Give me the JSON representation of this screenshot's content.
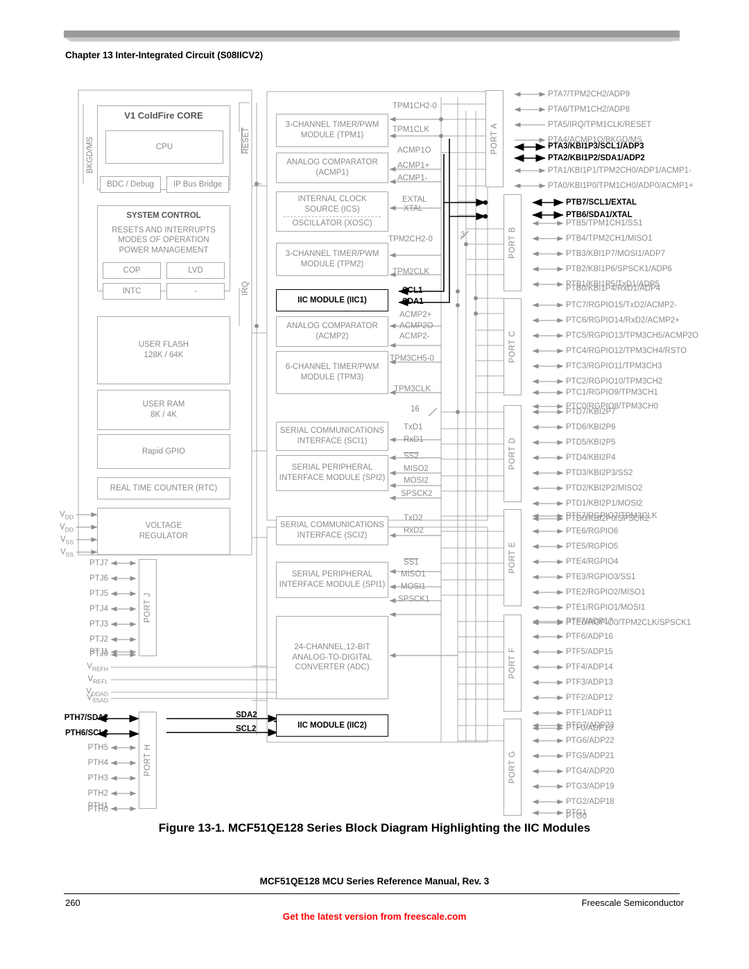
{
  "header": {
    "chapter": "Chapter 13 Inter-Integrated Circuit (S08IICV2)"
  },
  "footer": {
    "figure_caption": "Figure 13-1. MCF51QE128 Series Block Diagram Highlighting the IIC Modules",
    "manual_line": "MCF51QE128 MCU Series Reference Manual, Rev. 3",
    "page_number": "260",
    "company": "Freescale Semiconductor",
    "notice": "Get the latest version from freescale.com"
  },
  "colors": {
    "normal": "#8a8a8a",
    "highlight": "#000000",
    "notice_red": "#ff0000",
    "rule": "#9a9a9a"
  },
  "core": {
    "title": "V1 ColdFire CORE",
    "cpu": "CPU",
    "bdc": "BDC / Debug",
    "bus_bridge": "IP Bus Bridge",
    "bkgd_ms": "BKGD/MS",
    "reset": "RESET",
    "irq": "IRQ"
  },
  "system_control": {
    "title": "SYSTEM CONTROL",
    "lines": [
      "RESETS AND INTERRUPTS",
      "MODES OF OPERATION",
      "POWER MANAGEMENT"
    ],
    "cop": "COP",
    "lvd": "LVD",
    "intc": "INTC",
    "spare": "-"
  },
  "memory": {
    "flash_title": "USER FLASH",
    "flash_size": "128K / 64K",
    "ram_title": "USER RAM",
    "ram_size": "8K / 4K",
    "rgpio": "Rapid GPIO",
    "rtc": "REAL TIME COUNTER (RTC)",
    "vreg_l1": "VOLTAGE",
    "vreg_l2": "REGULATOR"
  },
  "power_pins": [
    "VDD",
    "VDD",
    "VSS",
    "VSS"
  ],
  "adc_ref_pins": [
    "VREFH",
    "VREFL",
    "VDDAD",
    "VSSAD"
  ],
  "modules": [
    {
      "id": "tpm1",
      "l1": "3-CHANNEL TIMER/PWM",
      "l2": "MODULE (TPM1)",
      "highlight": false
    },
    {
      "id": "acmp1",
      "l1": "ANALOG COMPARATOR",
      "l2": "(ACMP1)",
      "highlight": false
    },
    {
      "id": "ics",
      "l1": "INTERNAL CLOCK",
      "l2": "SOURCE (ICS)",
      "l3": "OSCILLATOR (XOSC)",
      "highlight": false
    },
    {
      "id": "tpm2",
      "l1": "3-CHANNEL TIMER/PWM",
      "l2": "MODULE (TPM2)",
      "highlight": false
    },
    {
      "id": "iic1",
      "l1": "IIC MODULE (IIC1)",
      "highlight": true
    },
    {
      "id": "acmp2",
      "l1": "ANALOG COMPARATOR",
      "l2": "(ACMP2)",
      "highlight": false
    },
    {
      "id": "tpm3",
      "l1": "6-CHANNEL TIMER/PWM",
      "l2": "MODULE (TPM3)",
      "highlight": false
    },
    {
      "id": "sci1",
      "l1": "SERIAL COMMUNICATIONS",
      "l2": "INTERFACE (SCI1)",
      "highlight": false
    },
    {
      "id": "spi2",
      "l1": "SERIAL PERIPHERAL",
      "l2": "INTERFACE MODULE (SPI2)",
      "highlight": false
    },
    {
      "id": "sci2",
      "l1": "SERIAL COMMUNICATIONS",
      "l2": "INTERFACE (SCI2)",
      "highlight": false
    },
    {
      "id": "spi1",
      "l1": "SERIAL PERIPHERAL",
      "l2": "INTERFACE MODULE (SPI1)",
      "highlight": false
    },
    {
      "id": "adc",
      "l1": "24-CHANNEL,12-BIT",
      "l2": "ANALOG-TO-DIGITAL",
      "l3": "CONVERTER (ADC)",
      "highlight": false
    },
    {
      "id": "iic2",
      "l1": "IIC MODULE (IIC2)",
      "highlight": true
    }
  ],
  "signals": [
    {
      "t": "TPM1CH2-0",
      "hl": false
    },
    {
      "t": "TPM1CLK",
      "hl": false
    },
    {
      "t": "ACMP1O",
      "hl": false
    },
    {
      "t": "ACMP1+",
      "hl": false
    },
    {
      "t": "ACMP1-",
      "hl": false
    },
    {
      "t": "EXTAL",
      "hl": false
    },
    {
      "t": "XTAL",
      "hl": false
    },
    {
      "t": "TPM2CH2-0",
      "hl": false
    },
    {
      "t": "TPM2CLK",
      "hl": false
    },
    {
      "t": "SCL1",
      "hl": true
    },
    {
      "t": "SDA1",
      "hl": true
    },
    {
      "t": "ACMP2+",
      "hl": false
    },
    {
      "t": "ACMP2O",
      "hl": false
    },
    {
      "t": "ACMP2-",
      "hl": false
    },
    {
      "t": "TPM3CH5-0",
      "hl": false
    },
    {
      "t": "TPM3CLK",
      "hl": false
    },
    {
      "t": "16",
      "hl": false
    },
    {
      "t": "TxD1",
      "hl": false
    },
    {
      "t": "RxD1",
      "hl": false
    },
    {
      "t": "SS2",
      "hl": false
    },
    {
      "t": "MISO2",
      "hl": false
    },
    {
      "t": "MOSI2",
      "hl": false
    },
    {
      "t": "SPSCK2",
      "hl": false
    },
    {
      "t": "TxD2",
      "hl": false
    },
    {
      "t": "RxD2",
      "hl": false
    },
    {
      "t": "SS1",
      "hl": false
    },
    {
      "t": "MISO1",
      "hl": false
    },
    {
      "t": "MOSI1",
      "hl": false
    },
    {
      "t": "SPSCK1",
      "hl": false
    },
    {
      "t": "SDA2",
      "hl": true
    },
    {
      "t": "SCL2",
      "hl": true
    },
    {
      "t": "3",
      "hl": false
    }
  ],
  "ports": {
    "a": {
      "label": "PORT A",
      "pins": [
        {
          "t": "PTA7/TPM2CH2/ADP9",
          "hl": false
        },
        {
          "t": "PTA6/TPM1CH2/ADP8",
          "hl": false
        },
        {
          "t": "PTA5/IRQ/TPM1CLK/RESET",
          "hl": false
        },
        {
          "t": "PTA4/ACMP1O/BKGD/MS",
          "hl": false
        },
        {
          "t": "PTA3/KBI1P3/SCL1/ADP3",
          "hl": true
        },
        {
          "t": "PTA2/KBI1P2/SDA1/ADP2",
          "hl": true
        },
        {
          "t": "PTA1/KBI1P1/TPM2CH0/ADP1/ACMP1-",
          "hl": false
        },
        {
          "t": "PTA0/KBI1P0/TPM1CH0/ADP0/ACMP1+",
          "hl": false
        }
      ]
    },
    "b": {
      "label": "PORT B",
      "pins": [
        {
          "t": "PTB7/SCL1/EXTAL",
          "hl": true
        },
        {
          "t": "PTB6/SDA1/XTAL",
          "hl": true
        },
        {
          "t": "PTB5/TPM1CH1/SS1",
          "hl": false
        },
        {
          "t": "PTB4/TPM2CH1/MISO1",
          "hl": false
        },
        {
          "t": "PTB3/KBI1P7/MOSI1/ADP7",
          "hl": false
        },
        {
          "t": "PTB2/KBI1P6/SPSCK1/ADP6",
          "hl": false
        },
        {
          "t": "PTB1/KBI1P5/TxD1/ADP5",
          "hl": false
        },
        {
          "t": "PTB0/KBI1P4/RxD1/ADP4",
          "hl": false
        }
      ]
    },
    "c": {
      "label": "PORT C",
      "pins": [
        {
          "t": "PTC7/RGPIO15/TxD2/ACMP2-",
          "hl": false
        },
        {
          "t": "PTC6/RGPIO14/RxD2/ACMP2+",
          "hl": false
        },
        {
          "t": "PTC5/RGPIO13/TPM3CH5/ACMP2O",
          "hl": false
        },
        {
          "t": "PTC4/RGPIO12/TPM3CH4/RSTO",
          "hl": false
        },
        {
          "t": "PTC3/RGPIO11/TPM3CH3",
          "hl": false
        },
        {
          "t": "PTC2/RGPIO10/TPM3CH2",
          "hl": false
        },
        {
          "t": "PTC1/RGPIO9/TPM3CH1",
          "hl": false
        },
        {
          "t": "PTC0/RGPIO8/TPM3CH0",
          "hl": false
        }
      ]
    },
    "d": {
      "label": "PORT D",
      "pins": [
        {
          "t": "PTD7/KBI2P7",
          "hl": false
        },
        {
          "t": "PTD6/KBI2P6",
          "hl": false
        },
        {
          "t": "PTD5/KBI2P5",
          "hl": false
        },
        {
          "t": "PTD4/KBI2P4",
          "hl": false
        },
        {
          "t": "PTD3/KBI2P3/SS2",
          "hl": false
        },
        {
          "t": "PTD2/KBI2P2/MISO2",
          "hl": false
        },
        {
          "t": "PTD1/KBI2P1/MOSI2",
          "hl": false
        },
        {
          "t": "PTD0/KBI2P0/SPSCK2",
          "hl": false
        }
      ]
    },
    "e": {
      "label": "PORT E",
      "pins": [
        {
          "t": "PTE7/RGPIO7/TPM3CLK",
          "hl": false
        },
        {
          "t": "PTE6/RGPIO6",
          "hl": false
        },
        {
          "t": "PTE5/RGPIO5",
          "hl": false
        },
        {
          "t": "PTE4/RGPIO4",
          "hl": false
        },
        {
          "t": "PTE3/RGPIO3/SS1",
          "hl": false
        },
        {
          "t": "PTE2/RGPIO2/MISO1",
          "hl": false
        },
        {
          "t": "PTE1/RGPIO1/MOSI1",
          "hl": false
        },
        {
          "t": "PTE0/RGPIO0/TPM2CLK/SPSCK1",
          "hl": false
        }
      ]
    },
    "f": {
      "label": "PORT F",
      "pins": [
        {
          "t": "PTF7/ADP17",
          "hl": false
        },
        {
          "t": "PTF6/ADP16",
          "hl": false
        },
        {
          "t": "PTF5/ADP15",
          "hl": false
        },
        {
          "t": "PTF4/ADP14",
          "hl": false
        },
        {
          "t": "PTF3/ADP13",
          "hl": false
        },
        {
          "t": "PTF2/ADP12",
          "hl": false
        },
        {
          "t": "PTF1/ADP11",
          "hl": false
        },
        {
          "t": "PTF0/ADP10",
          "hl": false
        }
      ]
    },
    "g": {
      "label": "PORT G",
      "pins": [
        {
          "t": "PTG7/ADP23",
          "hl": false
        },
        {
          "t": "PTG6/ADP22",
          "hl": false
        },
        {
          "t": "PTG5/ADP21",
          "hl": false
        },
        {
          "t": "PTG4/ADP20",
          "hl": false
        },
        {
          "t": "PTG3/ADP19",
          "hl": false
        },
        {
          "t": "PTG2/ADP18",
          "hl": false
        },
        {
          "t": "PTG1",
          "hl": false
        },
        {
          "t": "PTG0",
          "hl": false
        }
      ]
    },
    "j": {
      "label": "PORT J",
      "pins": [
        {
          "t": "PTJ7",
          "hl": false
        },
        {
          "t": "PTJ6",
          "hl": false
        },
        {
          "t": "PTJ5",
          "hl": false
        },
        {
          "t": "PTJ4",
          "hl": false
        },
        {
          "t": "PTJ3",
          "hl": false
        },
        {
          "t": "PTJ2",
          "hl": false
        },
        {
          "t": "PTJ1",
          "hl": false
        },
        {
          "t": "PTJ0",
          "hl": false
        }
      ]
    },
    "h": {
      "label": "PORT H",
      "pins": [
        {
          "t": "PTH7/SDA2",
          "hl": true
        },
        {
          "t": "PTH6/SCL2",
          "hl": true
        },
        {
          "t": "PTH5",
          "hl": false
        },
        {
          "t": "PTH4",
          "hl": false
        },
        {
          "t": "PTH3",
          "hl": false
        },
        {
          "t": "PTH2",
          "hl": false
        },
        {
          "t": "PTH1",
          "hl": false
        },
        {
          "t": "PTH0",
          "hl": false
        }
      ]
    }
  }
}
